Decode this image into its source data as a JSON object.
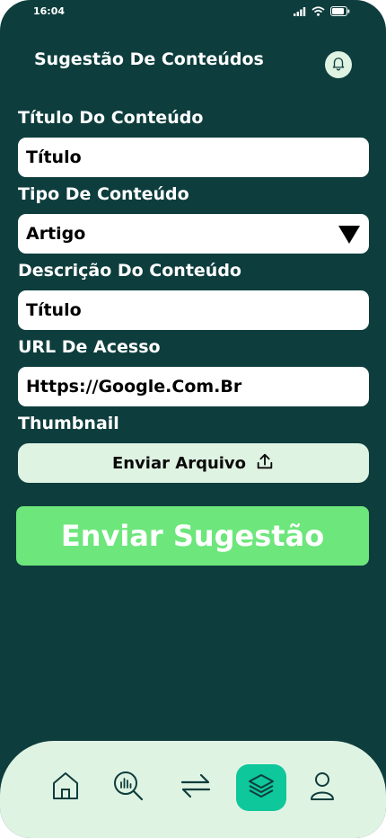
{
  "status_bar": {
    "time": "16:04"
  },
  "header": {
    "title": "Sugestão De Conteúdos"
  },
  "form": {
    "title_label": "Título Do Conteúdo",
    "title_value": "Título",
    "type_label": "Tipo De Conteúdo",
    "type_value": "Artigo",
    "description_label": "Descrição Do Conteúdo",
    "description_value": "Título",
    "url_label": "URL De Acesso",
    "url_value": "Https://Google.Com.Br",
    "thumbnail_label": "Thumbnail",
    "upload_label": "Enviar Arquivo",
    "submit_label": "Enviar Sugestão"
  },
  "nav": {
    "items": [
      {
        "icon": "home-icon"
      },
      {
        "icon": "analytics-search-icon"
      },
      {
        "icon": "transfer-arrows-icon"
      },
      {
        "icon": "layers-icon",
        "active": true
      },
      {
        "icon": "user-icon"
      }
    ]
  },
  "colors": {
    "background": "#0e3d3d",
    "accent_green": "#6de67c",
    "light_mint": "#dff3e3",
    "active_teal": "#0ec79b"
  }
}
